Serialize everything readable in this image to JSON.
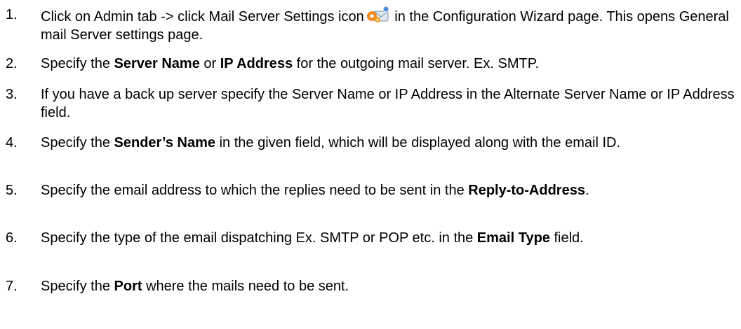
{
  "steps": [
    {
      "number": "1.",
      "text_a": "Click on Admin tab -> click Mail Server Settings icon",
      "icon": "mail-settings-icon",
      "text_b": " in the Configuration Wizard page. This opens General mail Server settings page."
    },
    {
      "number": "2.",
      "text_a": "Specify the ",
      "bold_1": "Server Name",
      "text_b": " or ",
      "bold_2": "IP Address",
      "text_c": " for the outgoing mail server. Ex. SMTP."
    },
    {
      "number": "3.",
      "text": "If you have a back up server specify the Server Name or IP Address in the Alternate Server Name or IP Address field."
    },
    {
      "number": "4.",
      "text_a": "Specify the ",
      "bold": "Sender’s Name",
      "text_b": " in the given field, which will be displayed along with the email ID."
    },
    {
      "number": "5.",
      "text_a": "Specify the email address to which the replies need to be sent in the ",
      "bold": "Reply-to-Address",
      "text_b": "."
    },
    {
      "number": "6.",
      "text_a": "Specify the type of the email dispatching Ex. SMTP or POP etc. in the ",
      "bold": "Email Type",
      "text_b": " field."
    },
    {
      "number": "7.",
      "text_a": "Specify the ",
      "bold": "Port",
      "text_b": " where the mails need to be sent."
    }
  ]
}
